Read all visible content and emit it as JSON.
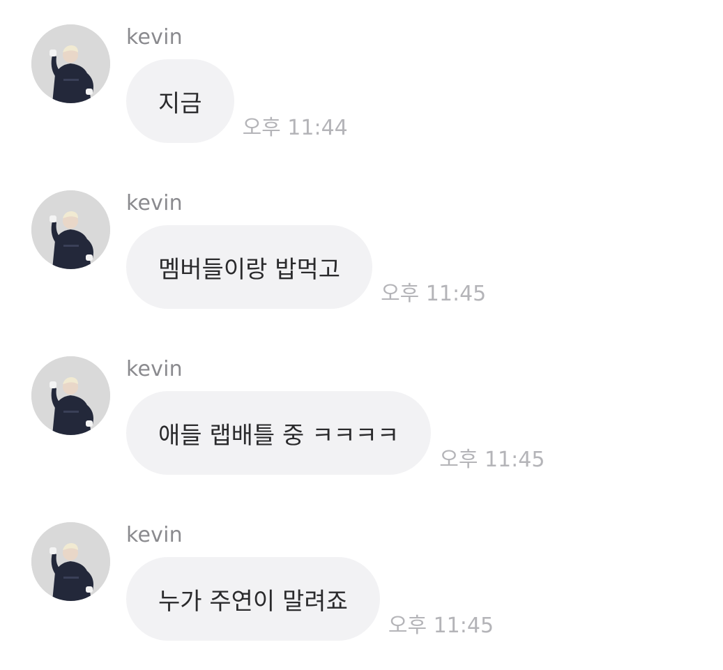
{
  "messages": [
    {
      "sender": "kevin",
      "text": "지금",
      "time": "오후 11:44"
    },
    {
      "sender": "kevin",
      "text": "멤버들이랑 밥먹고",
      "time": "오후 11:45"
    },
    {
      "sender": "kevin",
      "text": "애들 랩배틀 중 ㅋㅋㅋㅋ",
      "time": "오후 11:45"
    },
    {
      "sender": "kevin",
      "text": "누가 주연이 말려죠",
      "time": "오후 11:45"
    }
  ],
  "colors": {
    "bubble": "#f2f2f4",
    "sender": "#8a8a8e",
    "time": "#b4b4b8",
    "text": "#2a2a2c"
  },
  "icons": {
    "avatar": "profile-photo-person-in-dark-jumpsuit"
  }
}
